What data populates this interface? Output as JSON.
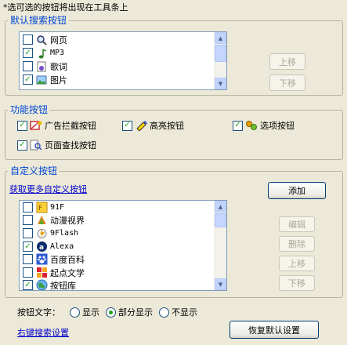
{
  "hint": "*选可选的按钮将出现在工具条上",
  "default_search": {
    "title": "默认搜索按钮",
    "items": [
      {
        "label": "网页",
        "checked": false,
        "icon": "magnifier-icon"
      },
      {
        "label": "MP3",
        "checked": true,
        "icon": "music-note-icon"
      },
      {
        "label": "歌词",
        "checked": false,
        "icon": "lyrics-icon"
      },
      {
        "label": "图片",
        "checked": true,
        "icon": "picture-icon"
      }
    ],
    "up_label": "上移",
    "down_label": "下移"
  },
  "function_buttons": {
    "title": "功能按钮",
    "items": [
      {
        "label": "广告拦截按钮",
        "checked": true,
        "icon": "ad-block-icon"
      },
      {
        "label": "高亮按钮",
        "checked": true,
        "icon": "highlighter-icon"
      },
      {
        "label": "选项按钮",
        "checked": true,
        "icon": "options-icon"
      },
      {
        "label": "页面查找按钮",
        "checked": true,
        "icon": "page-find-icon"
      }
    ]
  },
  "custom": {
    "title": "自定义按钮",
    "more_link": "获取更多自定义按钮",
    "add_label": "添加",
    "edit_label": "编辑",
    "delete_label": "删除",
    "up_label": "上移",
    "down_label": "下移",
    "items": [
      {
        "label": "91F",
        "checked": false,
        "icon": "91f-icon"
      },
      {
        "label": "动漫视界",
        "checked": false,
        "icon": "anime-icon"
      },
      {
        "label": "9Flash",
        "checked": false,
        "icon": "flash-icon"
      },
      {
        "label": "Alexa",
        "checked": true,
        "icon": "alexa-icon"
      },
      {
        "label": "百度百科",
        "checked": false,
        "icon": "baidu-paw-icon"
      },
      {
        "label": "起点文学",
        "checked": false,
        "icon": "qidian-icon"
      },
      {
        "label": "按钮库",
        "checked": true,
        "icon": "globe-icon"
      }
    ]
  },
  "button_text": {
    "label": "按钮文字：",
    "options": [
      {
        "label": "显示",
        "selected": false
      },
      {
        "label": "部分显示",
        "selected": true
      },
      {
        "label": "不显示",
        "selected": false
      }
    ]
  },
  "right_click_link": "右键搜索设置",
  "restore_label": "恢复默认设置",
  "colors": {
    "accent": "#0046d5",
    "check": "#21a121",
    "link": "#0000cc"
  }
}
